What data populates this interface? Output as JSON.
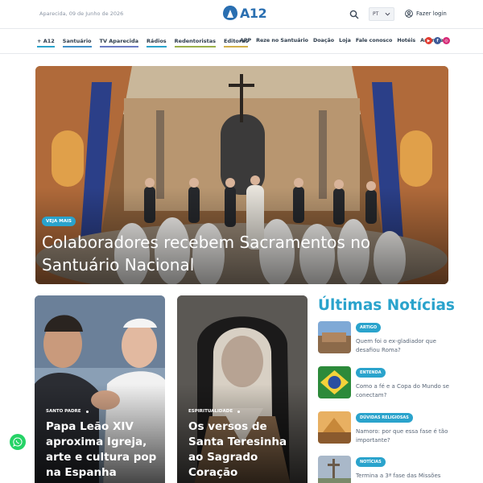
{
  "header": {
    "date": "Aparecida, 09 de Junho de 2026",
    "logo_text": "A12",
    "language": "PT",
    "login_label": "Fazer login"
  },
  "nav": {
    "primary": [
      {
        "label": "+ A12",
        "color": "#2aa3cc"
      },
      {
        "label": "Santuário",
        "color": "#3f8fc7"
      },
      {
        "label": "TV Aparecida",
        "color": "#6a7bc4"
      },
      {
        "label": "Rádios",
        "color": "#2aa3cc"
      },
      {
        "label": "Redentoristas",
        "color": "#9ab04a"
      },
      {
        "label": "Editoras",
        "color": "#d2b04a"
      }
    ],
    "secondary": [
      "APP",
      "Reze no Santuário",
      "Doação",
      "Loja",
      "Fale conosco",
      "Hotéis",
      "Anuncie"
    ],
    "socials": [
      {
        "icon": "youtube-icon",
        "color": "#e23a2f",
        "glyph": "▶"
      },
      {
        "icon": "facebook-icon",
        "color": "#3d5a98",
        "glyph": "f"
      },
      {
        "icon": "instagram-icon",
        "color": "#d62976",
        "glyph": "◎"
      }
    ]
  },
  "hero": {
    "badge": "VEJA MAIS",
    "title": "Colaboradores recebem Sacramentos no Santuário Nacional"
  },
  "cards": [
    {
      "category": "SANTO PADRE",
      "title": "Papa Leão XIV aproxima Igreja, arte e cultura pop na Espanha"
    },
    {
      "category": "ESPIRITUALIDADE",
      "title": "Os versos de Santa Teresinha ao Sagrado Coração"
    }
  ],
  "latest": {
    "title": "Últimas Notícias",
    "items": [
      {
        "badge": "ARTIGO",
        "text": "Quem foi o ex-gladiador que desafiou Roma?"
      },
      {
        "badge": "ENTENDA",
        "text": "Como a fé e a Copa do Mundo se conectam?"
      },
      {
        "badge": "DÚVIDAS RELIGIOSAS",
        "text": "Namoro: por que essa fase é tão importante?"
      },
      {
        "badge": "NOTÍCIAS",
        "text": "Termina a 3ª fase das Missões"
      }
    ]
  },
  "colors": {
    "accent": "#2aa3cc",
    "brand": "#2a6fb1",
    "whatsapp": "#25d366"
  }
}
